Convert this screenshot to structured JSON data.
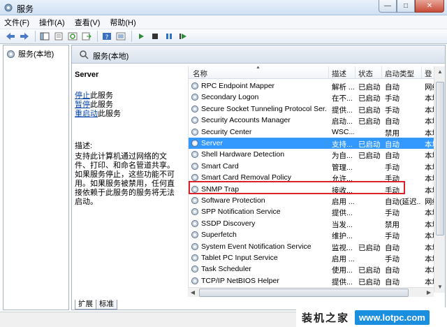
{
  "window": {
    "title": "服务",
    "buttons": {
      "minimize": "—",
      "maximize": "□",
      "close": "✕"
    }
  },
  "menu": [
    "文件(F)",
    "操作(A)",
    "查看(V)",
    "帮助(H)"
  ],
  "toolbar_icons": [
    "back-icon",
    "forward-icon",
    "console-tree-icon",
    "properties-icon",
    "refresh-icon",
    "export-icon",
    "help-icon",
    "view-icon",
    "play-icon",
    "stop-icon",
    "pause-icon",
    "restart-icon"
  ],
  "tree": {
    "root_label": "服务(本地)"
  },
  "pane": {
    "header": "服务(本地)"
  },
  "detail": {
    "service_name": "Server",
    "links": [
      {
        "link": "停止",
        "rest": "此服务"
      },
      {
        "link": "暂停",
        "rest": "此服务"
      },
      {
        "link": "重启动",
        "rest": "此服务"
      }
    ],
    "desc_label": "描述:",
    "desc_text": "支持此计算机通过网络的文件、打印、和命名管道共享。如果服务停止，这些功能不可用。如果服务被禁用，任何直接依赖于此服务的服务将无法启动。"
  },
  "columns": [
    "名称",
    "描述",
    "状态",
    "启动类型",
    "登"
  ],
  "rows": [
    {
      "name": "RPC Endpoint Mapper",
      "desc": "解析 ...",
      "status": "已启动",
      "startup": "自动",
      "logon": "网络"
    },
    {
      "name": "Secondary Logon",
      "desc": "在不...",
      "status": "已启动",
      "startup": "手动",
      "logon": "本地"
    },
    {
      "name": "Secure Socket Tunneling Protocol Ser...",
      "desc": "提供...",
      "status": "已启动",
      "startup": "手动",
      "logon": "本地"
    },
    {
      "name": "Security Accounts Manager",
      "desc": "启动...",
      "status": "已启动",
      "startup": "自动",
      "logon": "本地"
    },
    {
      "name": "Security Center",
      "desc": "WSC...",
      "status": "",
      "startup": "禁用",
      "logon": "本地"
    },
    {
      "name": "Server",
      "desc": "支持...",
      "status": "已启动",
      "startup": "自动",
      "logon": "本地",
      "selected": true
    },
    {
      "name": "Shell Hardware Detection",
      "desc": "为自...",
      "status": "已启动",
      "startup": "自动",
      "logon": "本地"
    },
    {
      "name": "Smart Card",
      "desc": "管理...",
      "status": "",
      "startup": "手动",
      "logon": "本地"
    },
    {
      "name": "Smart Card Removal Policy",
      "desc": "允许...",
      "status": "",
      "startup": "手动",
      "logon": "本地"
    },
    {
      "name": "SNMP Trap",
      "desc": "接收...",
      "status": "",
      "startup": "手动",
      "logon": "本地"
    },
    {
      "name": "Software Protection",
      "desc": "启用 ...",
      "status": "",
      "startup": "自动(延迟...",
      "logon": "网络"
    },
    {
      "name": "SPP Notification Service",
      "desc": "提供...",
      "status": "",
      "startup": "手动",
      "logon": "本地"
    },
    {
      "name": "SSDP Discovery",
      "desc": "当发...",
      "status": "",
      "startup": "禁用",
      "logon": "本地"
    },
    {
      "name": "Superfetch",
      "desc": "维护...",
      "status": "",
      "startup": "手动",
      "logon": "本地"
    },
    {
      "name": "System Event Notification Service",
      "desc": "监视...",
      "status": "已启动",
      "startup": "自动",
      "logon": "本地"
    },
    {
      "name": "Tablet PC Input Service",
      "desc": "启用 ...",
      "status": "",
      "startup": "手动",
      "logon": "本地"
    },
    {
      "name": "Task Scheduler",
      "desc": "使用...",
      "status": "已启动",
      "startup": "自动",
      "logon": "本地"
    },
    {
      "name": "TCP/IP NetBIOS Helper",
      "desc": "提供...",
      "status": "已启动",
      "startup": "自动",
      "logon": "本地"
    }
  ],
  "tabs": [
    "扩展",
    "标准"
  ],
  "watermark": {
    "name": "装机之家",
    "url": "www.lotpc.com"
  },
  "colors": {
    "selection": "#3399ff",
    "highlight_border": "#d8232a",
    "link": "#0645ad"
  }
}
